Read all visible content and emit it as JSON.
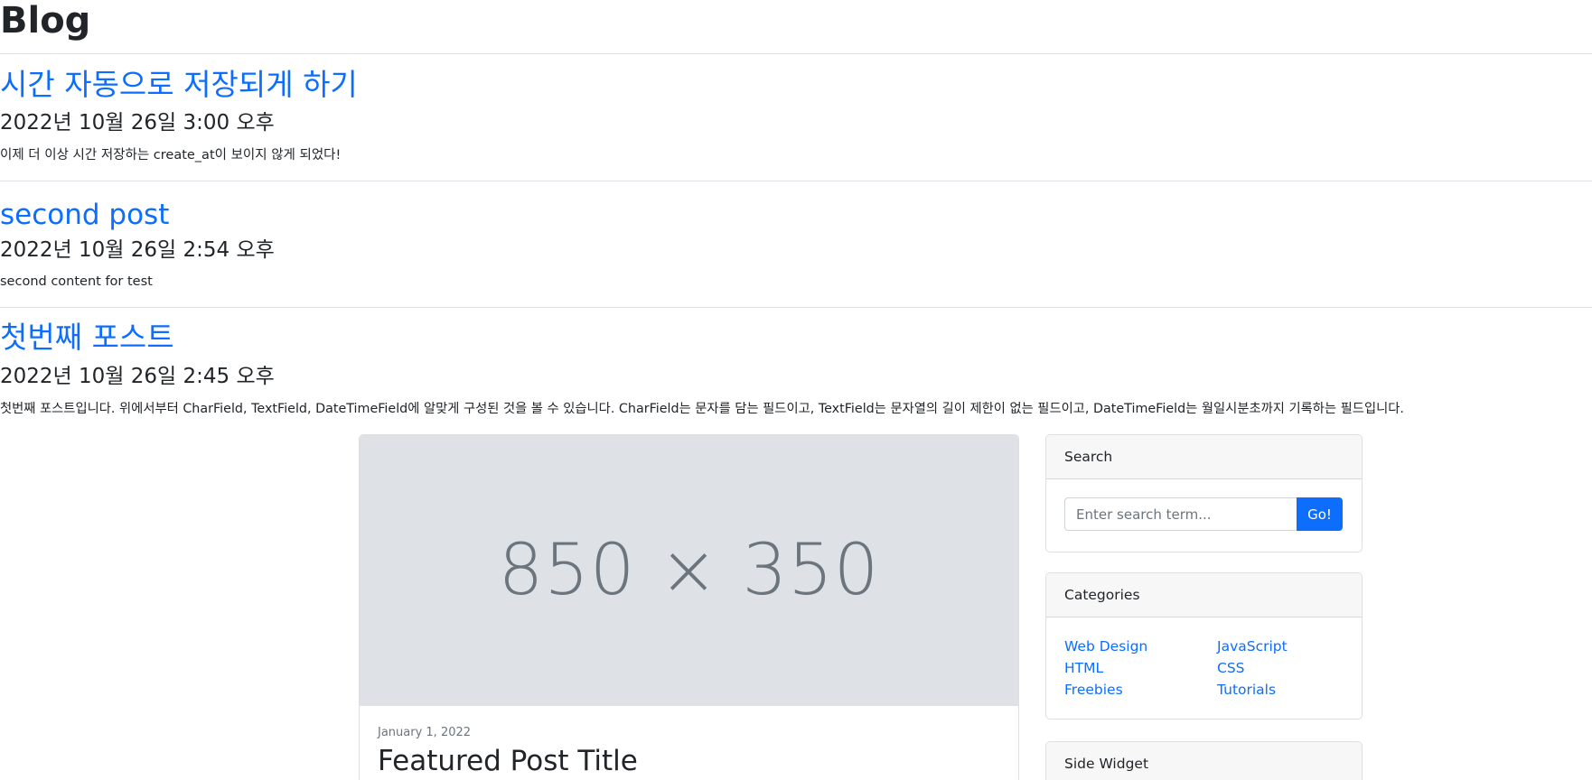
{
  "header": {
    "title": "Blog"
  },
  "posts": [
    {
      "title": "시간 자동으로 저장되게 하기",
      "date": "2022년 10월 26일 3:00 오후",
      "content": "이제 더 이상 시간 저장하는 create_at이 보이지 않게 되었다!"
    },
    {
      "title": "second post",
      "date": "2022년 10월 26일 2:54 오후",
      "content": "second content for test"
    },
    {
      "title": "첫번째 포스트",
      "date": "2022년 10월 26일 2:45 오후",
      "content": "첫번째 포스트입니다. 위에서부터 CharField, TextField, DateTimeField에 알맞게 구성된 것을 볼 수 있습니다. CharField는 문자를 담는 필드이고, TextField는 문자열의 길이 제한이 없는 필드이고, DateTimeField는 월일시분초까지 기록하는 필드입니다."
    }
  ],
  "featured": {
    "image_placeholder": "850 × 350",
    "date": "January 1, 2022",
    "title": "Featured Post Title"
  },
  "sidebar": {
    "search": {
      "header": "Search",
      "placeholder": "Enter search term...",
      "button": "Go!"
    },
    "categories": {
      "header": "Categories",
      "items": [
        "Web Design",
        "HTML",
        "Freebies",
        "JavaScript",
        "CSS",
        "Tutorials"
      ]
    },
    "side_widget": {
      "header": "Side Widget"
    }
  },
  "colors": {
    "link": "#0d6efd",
    "text": "#212529",
    "muted": "#6c757d",
    "placeholder_bg": "#dee2e6",
    "card_header_bg": "#f7f7f7"
  }
}
